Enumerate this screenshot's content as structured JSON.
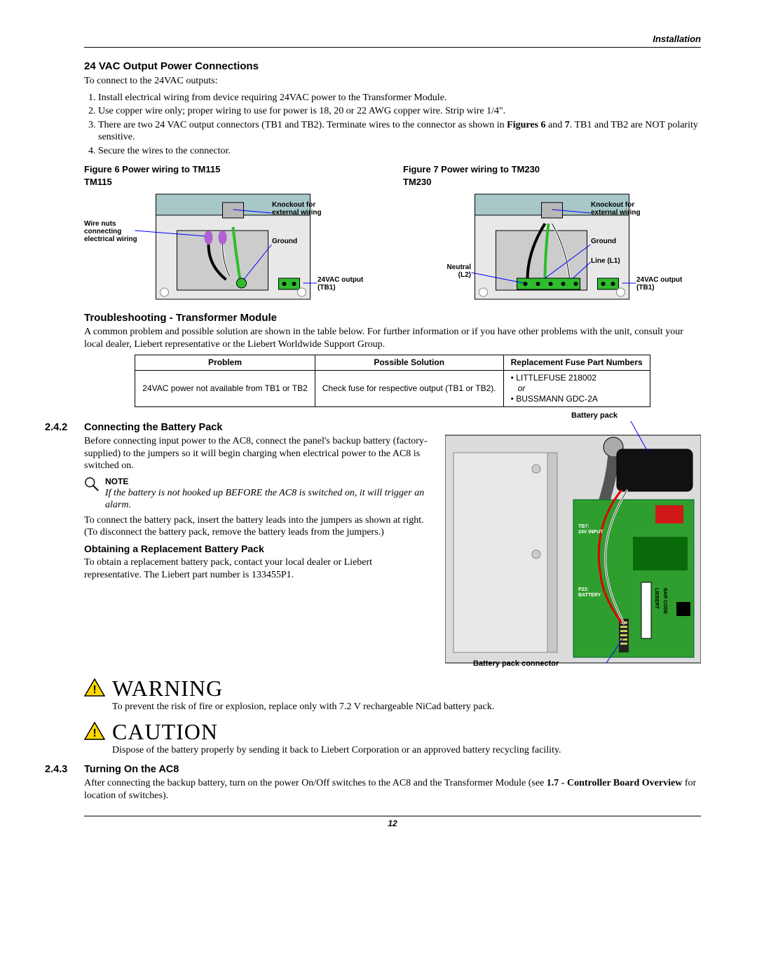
{
  "header": {
    "section": "Installation"
  },
  "s1": {
    "title": "24 VAC Output Power Connections",
    "intro": "To connect to the 24VAC outputs:",
    "steps": [
      "Install electrical wiring from device requiring 24VAC power to the Transformer Module.",
      "Use copper wire only; proper wiring to use for power is 18, 20 or 22 AWG copper wire. Strip wire 1/4\".",
      "There are two 24 VAC output connectors (TB1 and TB2). Terminate wires to the connector as shown in Figures 6 and 7. TB1 and TB2 are NOT polarity sensitive.",
      "Secure the wires to the connector."
    ],
    "fig6": {
      "caption": "Figure 6    Power wiring to TM115",
      "model": "TM115",
      "labels": {
        "wirenuts": "Wire nuts connecting electrical wiring",
        "knockout": "Knockout for external wiring",
        "ground": "Ground",
        "out": "24VAC output (TB1)"
      }
    },
    "fig7": {
      "caption": "Figure 7    Power wiring to TM230",
      "model": "TM230",
      "labels": {
        "neutral": "Neutral (L2)",
        "knockout": "Knockout for external wiring",
        "ground": "Ground",
        "line": "Line (L1)",
        "out": "24VAC output (TB1)"
      }
    }
  },
  "s2": {
    "title": "Troubleshooting - Transformer Module",
    "intro": "A common problem and possible solution are shown in the table below. For further information or if you have other problems with the unit, consult your local dealer, Liebert representative or the Liebert Worldwide Support Group.",
    "table": {
      "headers": [
        "Problem",
        "Possible Solution",
        "Replacement Fuse Part Numbers"
      ],
      "row": {
        "problem": "24VAC power not available from TB1 or TB2",
        "solution": "Check fuse for respective output (TB1 or TB2).",
        "fuse_a": "LITTLEFUSE 218002",
        "fuse_or": "or",
        "fuse_b": "BUSSMANN GDC-2A"
      }
    }
  },
  "s3": {
    "num": "2.4.2",
    "title": "Connecting the Battery Pack",
    "p1": "Before connecting input power to the AC8, connect the panel's backup battery (factory-supplied) to the jumpers so it will begin charging when electrical power to the AC8 is switched on.",
    "note_title": "NOTE",
    "note_body": "If the battery is not hooked up BEFORE the AC8 is switched on, it will trigger an alarm.",
    "p2": "To connect the battery pack, insert the battery leads into the jumpers as shown at right. (To disconnect the battery pack, remove the battery leads from the jumpers.)",
    "sub_title": "Obtaining a Replacement Battery Pack",
    "p3": "To obtain a replacement battery pack, contact your local dealer or Liebert representative. The Liebert part number is 133455P1.",
    "fig_labels": {
      "pack": "Battery pack",
      "tb7": "TB7: 24V INPUT",
      "p23": "P23: BATTERY",
      "conn": "Battery pack connector",
      "liebert": "LIEBERT",
      "barcode": "BAR CODE"
    }
  },
  "warning": {
    "title": "WARNING",
    "body": "To prevent the risk of fire or explosion, replace only with 7.2 V rechargeable NiCad battery pack."
  },
  "caution": {
    "title": "CAUTION",
    "body": "Dispose of the battery properly by sending it back to Liebert Corporation or an approved battery recycling facility."
  },
  "s4": {
    "num": "2.4.3",
    "title": "Turning On the AC8",
    "body_a": "After connecting the backup battery, turn on the power On/Off switches to the AC8 and the Transformer Module (see ",
    "body_b": "1.7 - Controller Board Overview",
    "body_c": " for location of switches)."
  },
  "footer": {
    "page": "12"
  }
}
